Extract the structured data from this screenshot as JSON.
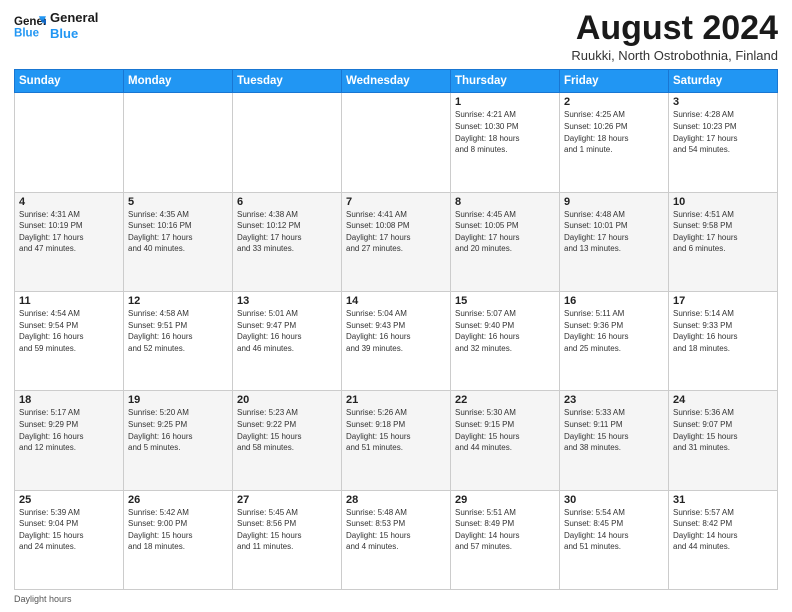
{
  "logo": {
    "line1": "General",
    "line2": "Blue"
  },
  "header": {
    "title": "August 2024",
    "subtitle": "Ruukki, North Ostrobothnia, Finland"
  },
  "days_of_week": [
    "Sunday",
    "Monday",
    "Tuesday",
    "Wednesday",
    "Thursday",
    "Friday",
    "Saturday"
  ],
  "footer": {
    "daylight_label": "Daylight hours"
  },
  "weeks": [
    [
      {
        "num": "",
        "info": ""
      },
      {
        "num": "",
        "info": ""
      },
      {
        "num": "",
        "info": ""
      },
      {
        "num": "",
        "info": ""
      },
      {
        "num": "1",
        "info": "Sunrise: 4:21 AM\nSunset: 10:30 PM\nDaylight: 18 hours\nand 8 minutes."
      },
      {
        "num": "2",
        "info": "Sunrise: 4:25 AM\nSunset: 10:26 PM\nDaylight: 18 hours\nand 1 minute."
      },
      {
        "num": "3",
        "info": "Sunrise: 4:28 AM\nSunset: 10:23 PM\nDaylight: 17 hours\nand 54 minutes."
      }
    ],
    [
      {
        "num": "4",
        "info": "Sunrise: 4:31 AM\nSunset: 10:19 PM\nDaylight: 17 hours\nand 47 minutes."
      },
      {
        "num": "5",
        "info": "Sunrise: 4:35 AM\nSunset: 10:16 PM\nDaylight: 17 hours\nand 40 minutes."
      },
      {
        "num": "6",
        "info": "Sunrise: 4:38 AM\nSunset: 10:12 PM\nDaylight: 17 hours\nand 33 minutes."
      },
      {
        "num": "7",
        "info": "Sunrise: 4:41 AM\nSunset: 10:08 PM\nDaylight: 17 hours\nand 27 minutes."
      },
      {
        "num": "8",
        "info": "Sunrise: 4:45 AM\nSunset: 10:05 PM\nDaylight: 17 hours\nand 20 minutes."
      },
      {
        "num": "9",
        "info": "Sunrise: 4:48 AM\nSunset: 10:01 PM\nDaylight: 17 hours\nand 13 minutes."
      },
      {
        "num": "10",
        "info": "Sunrise: 4:51 AM\nSunset: 9:58 PM\nDaylight: 17 hours\nand 6 minutes."
      }
    ],
    [
      {
        "num": "11",
        "info": "Sunrise: 4:54 AM\nSunset: 9:54 PM\nDaylight: 16 hours\nand 59 minutes."
      },
      {
        "num": "12",
        "info": "Sunrise: 4:58 AM\nSunset: 9:51 PM\nDaylight: 16 hours\nand 52 minutes."
      },
      {
        "num": "13",
        "info": "Sunrise: 5:01 AM\nSunset: 9:47 PM\nDaylight: 16 hours\nand 46 minutes."
      },
      {
        "num": "14",
        "info": "Sunrise: 5:04 AM\nSunset: 9:43 PM\nDaylight: 16 hours\nand 39 minutes."
      },
      {
        "num": "15",
        "info": "Sunrise: 5:07 AM\nSunset: 9:40 PM\nDaylight: 16 hours\nand 32 minutes."
      },
      {
        "num": "16",
        "info": "Sunrise: 5:11 AM\nSunset: 9:36 PM\nDaylight: 16 hours\nand 25 minutes."
      },
      {
        "num": "17",
        "info": "Sunrise: 5:14 AM\nSunset: 9:33 PM\nDaylight: 16 hours\nand 18 minutes."
      }
    ],
    [
      {
        "num": "18",
        "info": "Sunrise: 5:17 AM\nSunset: 9:29 PM\nDaylight: 16 hours\nand 12 minutes."
      },
      {
        "num": "19",
        "info": "Sunrise: 5:20 AM\nSunset: 9:25 PM\nDaylight: 16 hours\nand 5 minutes."
      },
      {
        "num": "20",
        "info": "Sunrise: 5:23 AM\nSunset: 9:22 PM\nDaylight: 15 hours\nand 58 minutes."
      },
      {
        "num": "21",
        "info": "Sunrise: 5:26 AM\nSunset: 9:18 PM\nDaylight: 15 hours\nand 51 minutes."
      },
      {
        "num": "22",
        "info": "Sunrise: 5:30 AM\nSunset: 9:15 PM\nDaylight: 15 hours\nand 44 minutes."
      },
      {
        "num": "23",
        "info": "Sunrise: 5:33 AM\nSunset: 9:11 PM\nDaylight: 15 hours\nand 38 minutes."
      },
      {
        "num": "24",
        "info": "Sunrise: 5:36 AM\nSunset: 9:07 PM\nDaylight: 15 hours\nand 31 minutes."
      }
    ],
    [
      {
        "num": "25",
        "info": "Sunrise: 5:39 AM\nSunset: 9:04 PM\nDaylight: 15 hours\nand 24 minutes."
      },
      {
        "num": "26",
        "info": "Sunrise: 5:42 AM\nSunset: 9:00 PM\nDaylight: 15 hours\nand 18 minutes."
      },
      {
        "num": "27",
        "info": "Sunrise: 5:45 AM\nSunset: 8:56 PM\nDaylight: 15 hours\nand 11 minutes."
      },
      {
        "num": "28",
        "info": "Sunrise: 5:48 AM\nSunset: 8:53 PM\nDaylight: 15 hours\nand 4 minutes."
      },
      {
        "num": "29",
        "info": "Sunrise: 5:51 AM\nSunset: 8:49 PM\nDaylight: 14 hours\nand 57 minutes."
      },
      {
        "num": "30",
        "info": "Sunrise: 5:54 AM\nSunset: 8:45 PM\nDaylight: 14 hours\nand 51 minutes."
      },
      {
        "num": "31",
        "info": "Sunrise: 5:57 AM\nSunset: 8:42 PM\nDaylight: 14 hours\nand 44 minutes."
      }
    ]
  ]
}
